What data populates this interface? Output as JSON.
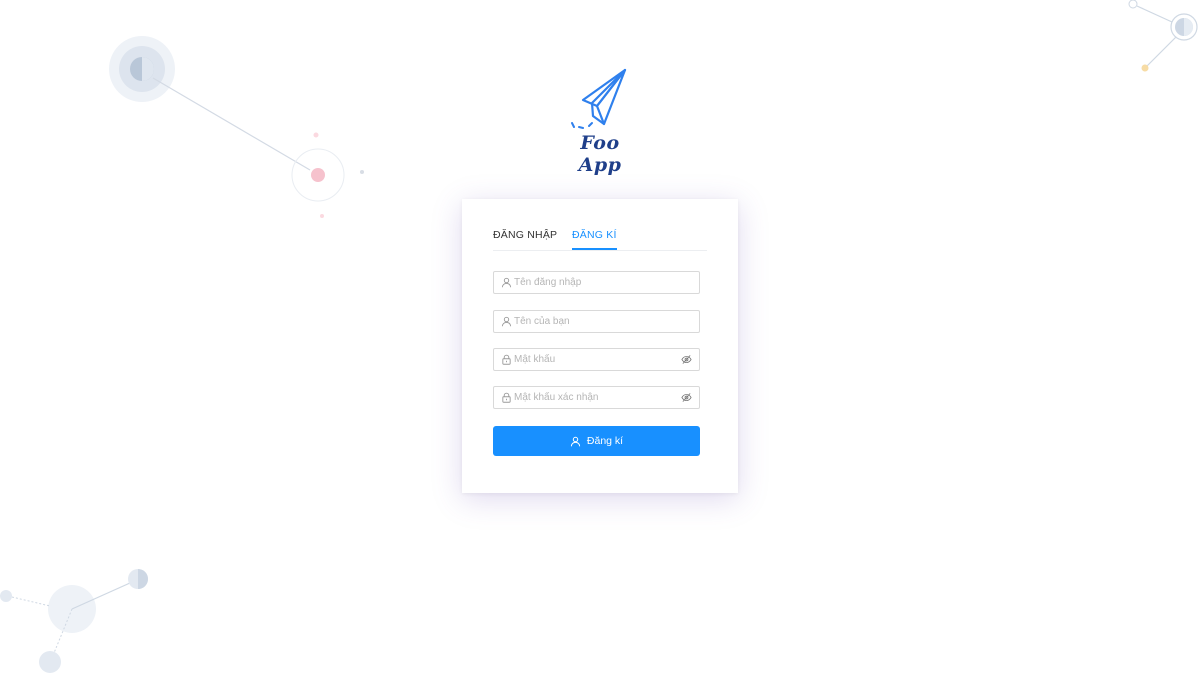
{
  "app": {
    "name": "Foo App"
  },
  "tabs": [
    {
      "label": "ĐĂNG NHẬP",
      "active": false
    },
    {
      "label": "ĐĂNG KÍ",
      "active": true
    }
  ],
  "form": {
    "username": {
      "placeholder": "Tên đăng nhập",
      "value": "",
      "icon": "user-icon"
    },
    "display_name": {
      "placeholder": "Tên của bạn",
      "value": "",
      "icon": "user-icon"
    },
    "password": {
      "placeholder": "Mật khẩu",
      "value": "",
      "icon": "lock-icon",
      "toggle_icon": "eye-invisible-icon"
    },
    "password_confirm": {
      "placeholder": "Mật khẩu xác nhận",
      "value": "",
      "icon": "lock-icon",
      "toggle_icon": "eye-invisible-icon"
    },
    "submit_label": "Đăng kí",
    "submit_icon": "user-icon"
  },
  "colors": {
    "primary": "#1890ff",
    "logo_blue": "#2f80ed",
    "logo_text": "#1f3f8a"
  }
}
